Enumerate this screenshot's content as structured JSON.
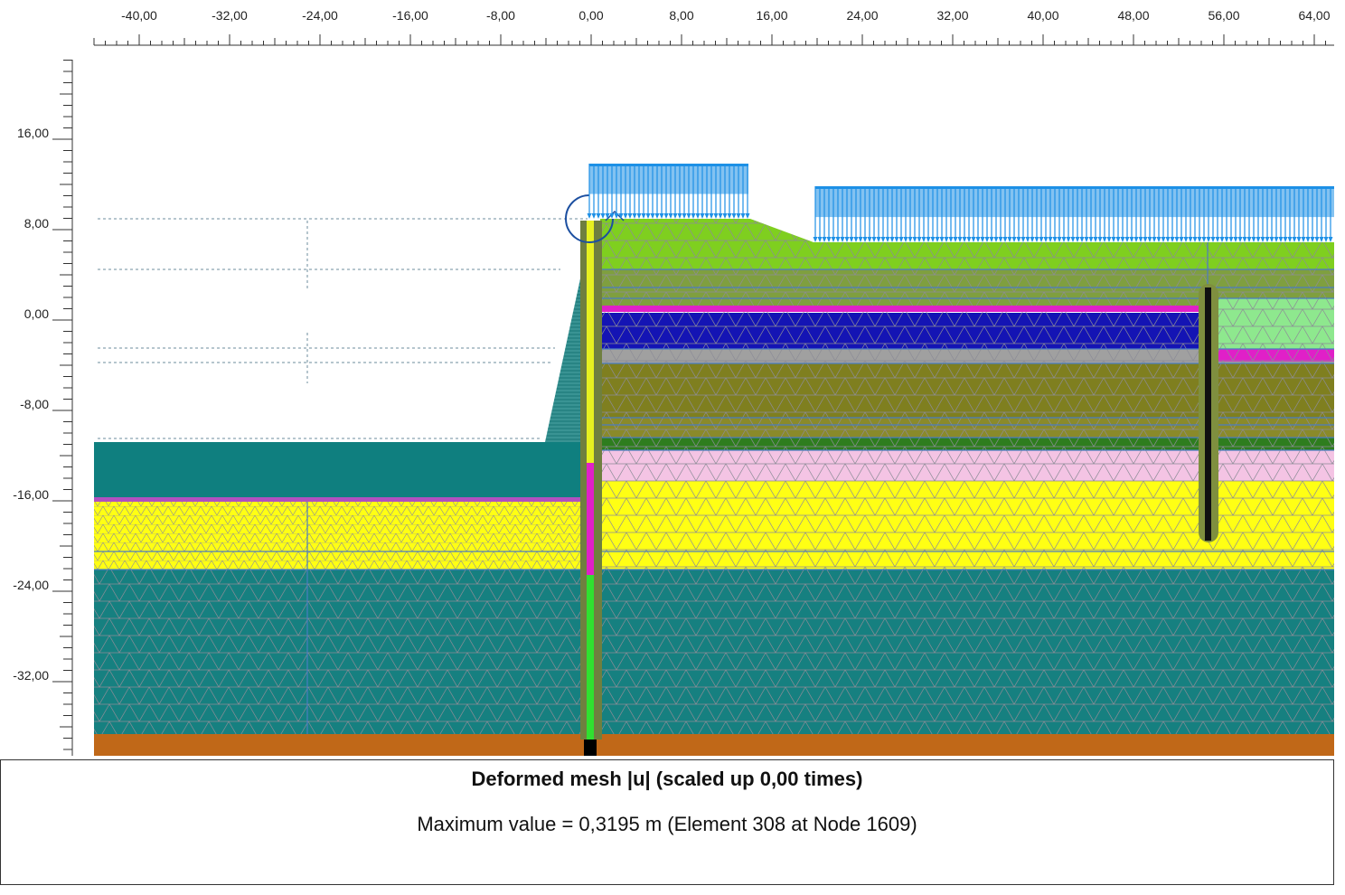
{
  "x_axis": {
    "ticks": [
      "-40,00",
      "-32,00",
      "-24,00",
      "-16,00",
      "-8,00",
      "0,00",
      "8,00",
      "16,00",
      "24,00",
      "32,00",
      "40,00",
      "48,00",
      "56,00",
      "64,00"
    ]
  },
  "y_axis": {
    "ticks": [
      "16,00",
      "8,00",
      "0,00",
      "-8,00",
      "-16,00",
      "-24,00",
      "-32,00"
    ]
  },
  "caption": {
    "title": "Deformed mesh |u| (scaled up 0,00 times)",
    "subtitle": "Maximum value = 0,3195 m (Element 308 at Node 1609)"
  },
  "colors": {
    "background": "#ffffff",
    "load": "#1e90e6",
    "water": "#0f7f7f",
    "green_fill": "#7fcf1f",
    "light_green": "#8ee88e",
    "olive": "#7f7f1f",
    "blue": "#1414b4",
    "gray": "#a0a0a0",
    "dark_green": "#2e7d1e",
    "pink": "#f4c4e4",
    "yellow": "#ffff14",
    "teal": "#168080",
    "brown": "#c06818",
    "magenta": "#e020c8",
    "sheet_wall_yellow": "#e6f020",
    "sheet_wall_green": "#30e030",
    "anchor": "#111111",
    "mesh_line": "#8c8c96"
  }
}
